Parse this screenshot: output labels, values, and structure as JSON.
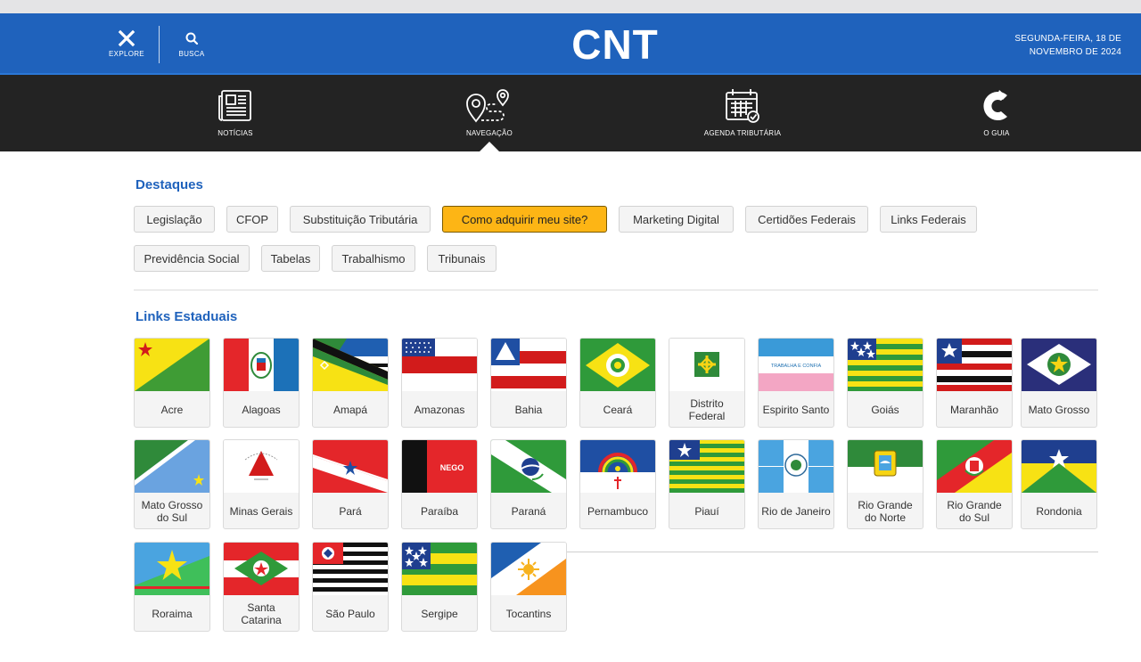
{
  "header": {
    "explore_label": "EXPLORE",
    "search_label": "BUSCA",
    "logo_text": "CNT",
    "date_line1": "SEGUNDA-FEIRA, 18 DE",
    "date_line2": "NOVEMBRO DE 2024",
    "bg_color": "#1f62bc"
  },
  "nav": {
    "items": [
      {
        "label": "NOTÍCIAS",
        "icon": "newspaper-icon"
      },
      {
        "label": "NAVEGAÇÃO",
        "icon": "route-pins-icon"
      },
      {
        "label": "AGENDA TRIBUTÁRIA",
        "icon": "calendar-check-icon"
      },
      {
        "label": "O GUIA",
        "icon": "c-logo-icon"
      }
    ],
    "active": "NAVEGAÇÃO"
  },
  "destaques": {
    "title": "Destaques",
    "chips": [
      "Legislação",
      "CFOP",
      "Substituição Tributária",
      "Como adquirir meu site?",
      "Marketing Digital",
      "Certidões Federais",
      "Links Federais",
      "Previdência Social",
      "Tabelas",
      "Trabalhismo",
      "Tribunais"
    ],
    "highlight_color": "#fdb515"
  },
  "estaduais": {
    "title": "Links Estaduais",
    "states": [
      {
        "name": "Acre",
        "flag": "ac"
      },
      {
        "name": "Alagoas",
        "flag": "al"
      },
      {
        "name": "Amapá",
        "flag": "ap"
      },
      {
        "name": "Amazonas",
        "flag": "am"
      },
      {
        "name": "Bahia",
        "flag": "ba"
      },
      {
        "name": "Ceará",
        "flag": "ce"
      },
      {
        "name": "Distrito Federal",
        "flag": "df"
      },
      {
        "name": "Espirito Santo",
        "flag": "es"
      },
      {
        "name": "Goiás",
        "flag": "go"
      },
      {
        "name": "Maranhão",
        "flag": "ma"
      },
      {
        "name": "Mato Grosso",
        "flag": "mt"
      },
      {
        "name": "Mato Grosso do Sul",
        "flag": "ms"
      },
      {
        "name": "Minas Gerais",
        "flag": "mg"
      },
      {
        "name": "Pará",
        "flag": "pa"
      },
      {
        "name": "Paraíba",
        "flag": "pb"
      },
      {
        "name": "Paraná",
        "flag": "pr"
      },
      {
        "name": "Pernambuco",
        "flag": "pe"
      },
      {
        "name": "Piauí",
        "flag": "pi"
      },
      {
        "name": "Rio de Janeiro",
        "flag": "rj"
      },
      {
        "name": "Rio Grande do Norte",
        "flag": "rn"
      },
      {
        "name": "Rio Grande do Sul",
        "flag": "rs"
      },
      {
        "name": "Rondonia",
        "flag": "ro"
      },
      {
        "name": "Roraima",
        "flag": "rr"
      },
      {
        "name": "Santa Catarina",
        "flag": "sc"
      },
      {
        "name": "São Paulo",
        "flag": "sp"
      },
      {
        "name": "Sergipe",
        "flag": "se"
      },
      {
        "name": "Tocantins",
        "flag": "to"
      }
    ],
    "flag_text": {
      "pb": "NEGO",
      "es": "TRABALHA E CONFIA"
    }
  }
}
